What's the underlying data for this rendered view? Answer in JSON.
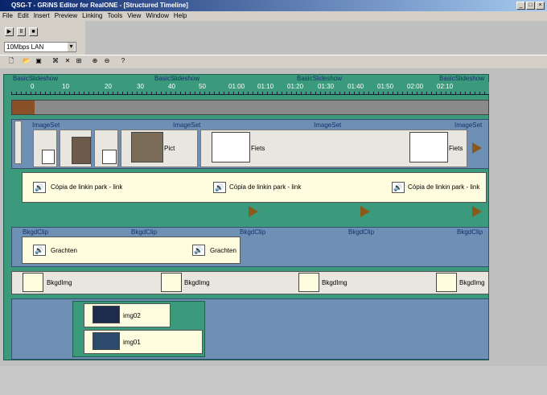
{
  "window": {
    "title": "QSG-T - GRiNS Editor for RealONE - [Structured Timeline]"
  },
  "menu": [
    "File",
    "Edit",
    "Insert",
    "Preview",
    "Linking",
    "Tools",
    "View",
    "Window",
    "Help"
  ],
  "player": {
    "bandwidth": "10Mbps LAN"
  },
  "timeline": {
    "root_label": "BasicSlideshow",
    "ruler": [
      "0",
      "10",
      "20",
      "30",
      "40",
      "50",
      "01:00",
      "01:10",
      "01:20",
      "01:30",
      "01:40",
      "01:50",
      "02:00",
      "02:10"
    ],
    "imageset_label": "ImageSet",
    "image_clips": [
      "Pict",
      "Fiets",
      "Fiets"
    ],
    "audio_clip": "Cópia de linkin park - link",
    "bkgdclip_label": "BkgdClip",
    "bkgd_audio": "Grachten",
    "bkgdimg_label": "BkgdImg",
    "imgs": [
      "img02",
      "img01"
    ]
  }
}
